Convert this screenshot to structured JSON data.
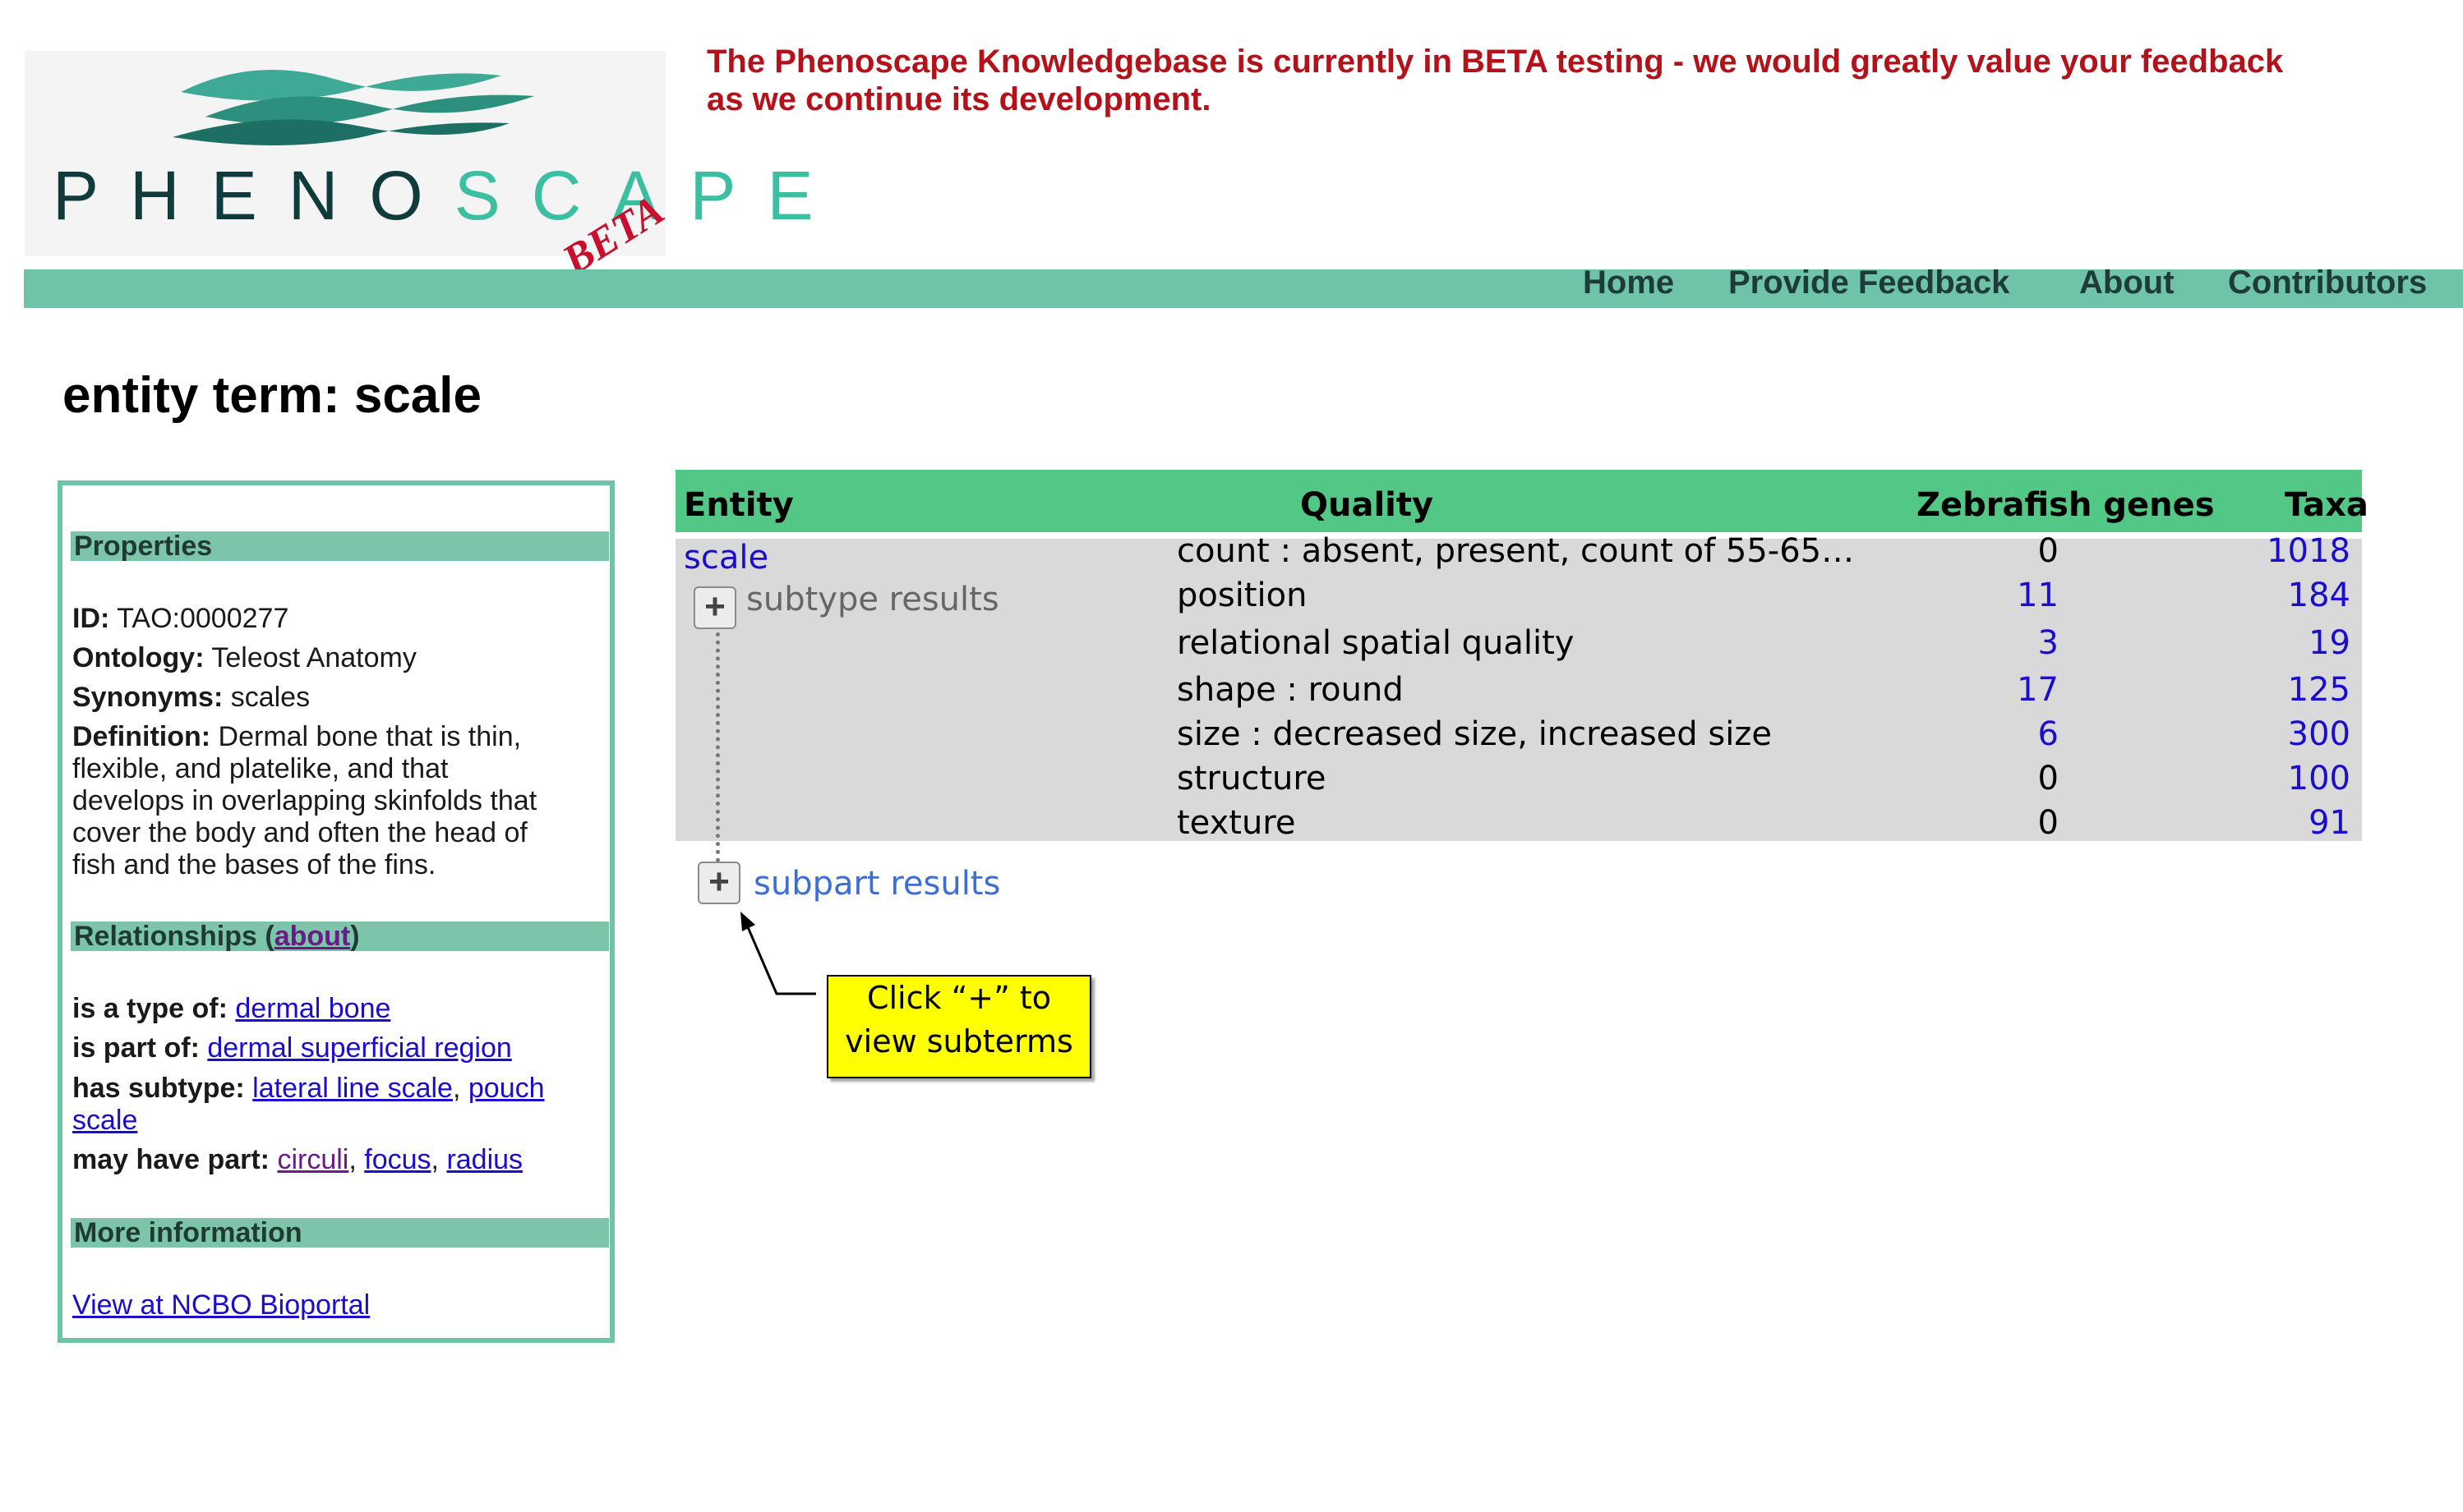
{
  "logo": {
    "word_dark": "PHENO",
    "word_teal": "SCAPE",
    "beta": "BETA"
  },
  "banner": {
    "line1": "The Phenoscape Knowledgebase is currently in BETA testing - we would greatly value your feedback",
    "line2": "as we continue its development."
  },
  "nav": {
    "home": "Home",
    "feedback": "Provide Feedback",
    "about": "About",
    "contributors": "Contributors"
  },
  "page_title": "entity term: scale",
  "sidebar": {
    "properties_header": "Properties",
    "id_label": "ID:",
    "id_value": "TAO:0000277",
    "ontology_label": "Ontology:",
    "ontology_value": "Teleost Anatomy",
    "synonyms_label": "Synonyms:",
    "synonyms_value": "scales",
    "definition_label": "Definition:",
    "definition_lines": [
      "Dermal bone that is thin,",
      "flexible, and platelike, and that",
      "develops in overlapping skinfolds that",
      "cover the body and often the head of",
      "fish and the bases of the fins."
    ],
    "relationships_header": "Relationships (",
    "relationships_about": "about",
    "relationships_close": ")",
    "is_type_label": "is a type of:",
    "is_type_link": "dermal bone",
    "is_part_label": "is part of:",
    "is_part_link": "dermal superficial region",
    "has_subtype_label": "has subtype:",
    "has_subtype_link1": "lateral line scale",
    "has_subtype_link2a": "pouch",
    "has_subtype_link2b": "scale",
    "may_have_label": "may have part:",
    "may_have_link1": "circuli",
    "may_have_link2": "focus",
    "may_have_link3": "radius",
    "more_header": "More information",
    "bioportal_link": "View at NCBO Bioportal"
  },
  "table": {
    "headers": {
      "entity": "Entity",
      "quality": "Quality",
      "genes": "Zebrafish genes",
      "taxa": "Taxa"
    },
    "entity": "scale",
    "rows": [
      {
        "quality": "count : absent, present, count of 55-65…",
        "genes": "0",
        "taxa": "1018"
      },
      {
        "quality": "position",
        "genes": "11",
        "taxa": "184"
      },
      {
        "quality": "relational spatial quality",
        "genes": "3",
        "taxa": "19"
      },
      {
        "quality": "shape : round",
        "genes": "17",
        "taxa": "125"
      },
      {
        "quality": "size : decreased size, increased size",
        "genes": "6",
        "taxa": "300"
      },
      {
        "quality": "structure",
        "genes": "0",
        "taxa": "100"
      },
      {
        "quality": "texture",
        "genes": "0",
        "taxa": "91"
      }
    ],
    "subtype_label": "subtype results",
    "subpart_label": "subpart results",
    "plus_glyph": "+"
  },
  "callout": {
    "line1": "Click “+” to",
    "line2": "view subterms"
  },
  "colors": {
    "nav": "#6fc3a8",
    "table_header": "#53c886",
    "banner": "#b4121b",
    "link": "#1a0dcc",
    "callout": "#ffff00"
  },
  "icons": {
    "expand": "plus-icon",
    "arrow": "arrow-pointer-icon"
  }
}
